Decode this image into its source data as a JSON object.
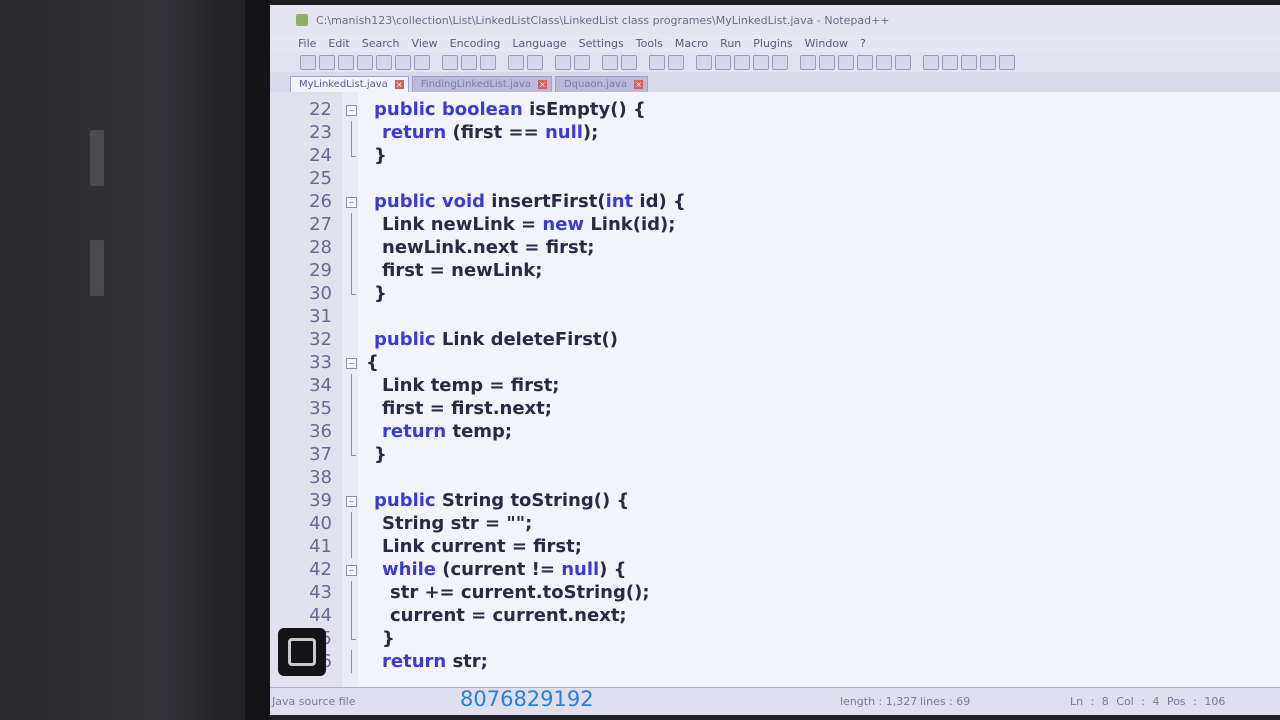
{
  "window": {
    "title": "C:\\manish123\\collection\\List\\LinkedListClass\\LinkedList class programes\\MyLinkedList.java - Notepad++"
  },
  "menu": [
    "File",
    "Edit",
    "Search",
    "View",
    "Encoding",
    "Language",
    "Settings",
    "Tools",
    "Macro",
    "Run",
    "Plugins",
    "Window",
    "?"
  ],
  "tabs": [
    {
      "label": "MyLinkedList.java",
      "active": true
    },
    {
      "label": "FindingLinkedList.java",
      "active": false
    },
    {
      "label": "Dquaon.java",
      "active": false
    }
  ],
  "editor": {
    "lines": [
      {
        "num": "22",
        "fold": "box-minus",
        "indent": 1,
        "parts": [
          [
            "kw",
            "public boolean "
          ],
          [
            "id",
            "isEmpty() {"
          ]
        ]
      },
      {
        "num": "23",
        "fold": "line",
        "indent": 2,
        "parts": [
          [
            "kw",
            "return "
          ],
          [
            "id",
            "(first == "
          ],
          [
            "kw",
            "null"
          ],
          [
            "id",
            ");"
          ]
        ]
      },
      {
        "num": "24",
        "fold": "end",
        "indent": 1,
        "parts": [
          [
            "id",
            "}"
          ]
        ]
      },
      {
        "num": "25",
        "fold": "",
        "indent": 0,
        "parts": []
      },
      {
        "num": "26",
        "fold": "box-minus",
        "indent": 1,
        "parts": [
          [
            "kw",
            "public void "
          ],
          [
            "id",
            "insertFirst("
          ],
          [
            "kw",
            "int "
          ],
          [
            "id",
            "id) {"
          ]
        ]
      },
      {
        "num": "27",
        "fold": "line",
        "indent": 2,
        "parts": [
          [
            "id",
            "Link newLink = "
          ],
          [
            "kw",
            "new "
          ],
          [
            "id",
            "Link(id);"
          ]
        ]
      },
      {
        "num": "28",
        "fold": "line",
        "indent": 2,
        "parts": [
          [
            "id",
            "newLink.next = first;"
          ]
        ]
      },
      {
        "num": "29",
        "fold": "line",
        "indent": 2,
        "parts": [
          [
            "id",
            "first = newLink;"
          ]
        ]
      },
      {
        "num": "30",
        "fold": "end",
        "indent": 1,
        "parts": [
          [
            "id",
            "}"
          ]
        ]
      },
      {
        "num": "31",
        "fold": "",
        "indent": 0,
        "parts": []
      },
      {
        "num": "32",
        "fold": "",
        "indent": 1,
        "parts": [
          [
            "kw",
            "public "
          ],
          [
            "id",
            "Link deleteFirst()"
          ]
        ]
      },
      {
        "num": "33",
        "fold": "box-minus",
        "indent": 0,
        "parts": [
          [
            "id",
            "{"
          ]
        ]
      },
      {
        "num": "34",
        "fold": "line",
        "indent": 2,
        "parts": [
          [
            "id",
            "Link temp = first;"
          ]
        ]
      },
      {
        "num": "35",
        "fold": "line",
        "indent": 2,
        "parts": [
          [
            "id",
            "first = first.next;"
          ]
        ]
      },
      {
        "num": "36",
        "fold": "line",
        "indent": 2,
        "parts": [
          [
            "kw",
            "return "
          ],
          [
            "id",
            "temp;"
          ]
        ]
      },
      {
        "num": "37",
        "fold": "end",
        "indent": 1,
        "parts": [
          [
            "id",
            "}"
          ]
        ]
      },
      {
        "num": "38",
        "fold": "",
        "indent": 0,
        "parts": []
      },
      {
        "num": "39",
        "fold": "box-minus",
        "indent": 1,
        "parts": [
          [
            "kw",
            "public "
          ],
          [
            "id",
            "String toString() {"
          ]
        ]
      },
      {
        "num": "40",
        "fold": "line",
        "indent": 2,
        "parts": [
          [
            "id",
            "String str = \"\";"
          ]
        ]
      },
      {
        "num": "41",
        "fold": "line",
        "indent": 2,
        "parts": [
          [
            "id",
            "Link current = first;"
          ]
        ]
      },
      {
        "num": "42",
        "fold": "box-minus",
        "indent": 2,
        "parts": [
          [
            "kw",
            "while "
          ],
          [
            "id",
            "(current != "
          ],
          [
            "kw",
            "null"
          ],
          [
            "id",
            ") {"
          ]
        ]
      },
      {
        "num": "43",
        "fold": "line",
        "indent": 3,
        "parts": [
          [
            "id",
            "str += current.toString();"
          ]
        ]
      },
      {
        "num": "44",
        "fold": "line",
        "indent": 3,
        "parts": [
          [
            "id",
            "current = current.next;"
          ]
        ]
      },
      {
        "num": "45",
        "fold": "end",
        "indent": 2,
        "parts": [
          [
            "id",
            "}"
          ]
        ]
      },
      {
        "num": "46",
        "fold": "line",
        "indent": 2,
        "parts": [
          [
            "kw",
            "return "
          ],
          [
            "id",
            "str;"
          ]
        ]
      }
    ]
  },
  "status": {
    "file_type": "Java source file",
    "length": "length : 1,327",
    "lines": "lines : 69",
    "position": "Ln : 8   Col : 4   Pos : 106"
  },
  "overlay": {
    "phone": "8076829192"
  },
  "colors": {
    "keyword": "#3b3bd0",
    "identifier": "#2a2a44",
    "overlay_phone": "#2c7fd8"
  }
}
